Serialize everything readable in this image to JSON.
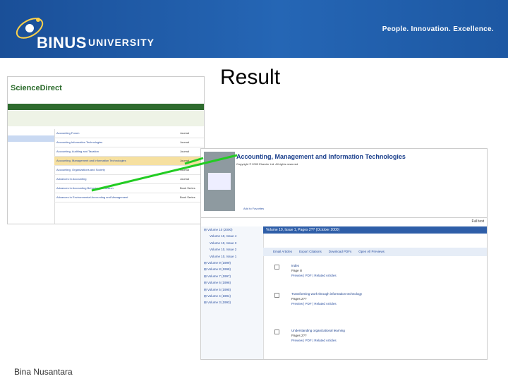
{
  "header": {
    "logo_text": "BINUS",
    "logo_suffix": "UNIVERSITY",
    "tagline": "People. Innovation. Excellence."
  },
  "slide": {
    "title": "Result",
    "footer": "Bina Nusantara"
  },
  "sciencedirect": {
    "logo": "ScienceDirect",
    "nav_tabs": [
      "Home",
      "Browse",
      "Search",
      "My Settings",
      "Alerts",
      "Help"
    ],
    "rows": [
      {
        "title": "Accounting Forum",
        "type": "Journal"
      },
      {
        "title": "Accounting Information Technologies",
        "type": "Journal"
      },
      {
        "title": "Accounting, Auditing and Taxation",
        "type": "Journal"
      },
      {
        "title": "Accounting, Management and Information Technologies",
        "type": "Journal"
      },
      {
        "title": "Accounting, Organizations and Society",
        "type": "Journal"
      },
      {
        "title": "Advances in Accounting",
        "type": "Journal"
      },
      {
        "title": "Advances in Accounting Behavioral Research",
        "type": "Book Series"
      },
      {
        "title": "Advances in Environmental Accounting and Management",
        "type": "Book Series"
      }
    ]
  },
  "journal": {
    "title": "Accounting, Management and Information Technologies",
    "copyright": "Copyright © 2003 Elsevier Ltd. All rights reserved",
    "add_to_favorites": "Add to Favorites"
  },
  "volumes": {
    "full_text": "Full text",
    "header": "Volume 10, Issue 1, Pages 2?? (October 2000)",
    "toolbar": [
      "Email Articles",
      "Export Citations",
      "Download PDFs",
      "Open All Previews"
    ],
    "items": [
      {
        "label": "Volume 10 (2000)",
        "kind": "vol"
      },
      {
        "label": "Volume 10, Issue 4",
        "kind": "issue"
      },
      {
        "label": "Volume 10, Issue 3",
        "kind": "issue"
      },
      {
        "label": "Volume 10, Issue 2",
        "kind": "issue"
      },
      {
        "label": "Volume 10, Issue 1",
        "kind": "issue"
      },
      {
        "label": "Volume 9 (1999)",
        "kind": "vol"
      },
      {
        "label": "Volume 8 (1998)",
        "kind": "vol"
      },
      {
        "label": "Volume 7 (1997)",
        "kind": "vol"
      },
      {
        "label": "Volume 6 (1996)",
        "kind": "vol"
      },
      {
        "label": "Volume 5 (1995)",
        "kind": "vol"
      },
      {
        "label": "Volume 4 (1994)",
        "kind": "vol"
      },
      {
        "label": "Volume 3 (1993)",
        "kind": "vol"
      }
    ],
    "articles": [
      {
        "num": "1",
        "title": "Index",
        "meta": "Page iii",
        "links": "Preview | PDF | Related Articles"
      },
      {
        "num": "2",
        "title": "Transforming work through information technology",
        "meta": "Pages 2??",
        "links": "Preview | PDF | Related Articles"
      },
      {
        "num": "3",
        "title": "Understanding organizational learning",
        "meta": "Pages 2??",
        "links": "Preview | PDF | Related Articles"
      }
    ]
  },
  "colors": {
    "header_blue": "#1f5aa6",
    "arrow_green": "#22cc22",
    "sd_green": "#2e6b2e"
  }
}
